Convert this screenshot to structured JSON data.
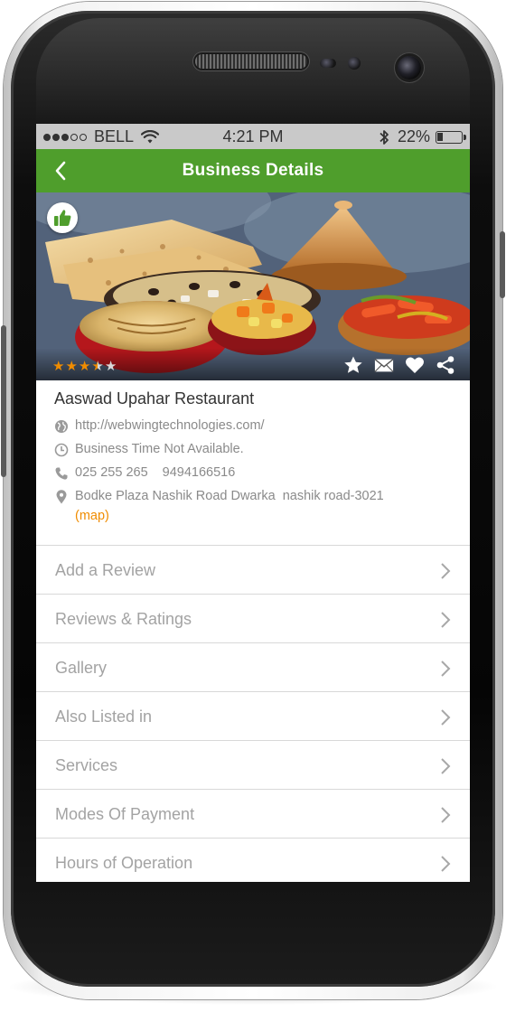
{
  "status_bar": {
    "carrier": "BELL",
    "time": "4:21 PM",
    "battery": "22%",
    "battery_level": 0.22
  },
  "nav": {
    "title": "Business Details",
    "back_icon": "chevron-left-icon"
  },
  "hero": {
    "rating": 3.5,
    "rating_max": 5,
    "badge_icon": "thumbs-up-icon",
    "actions": [
      "star-icon",
      "mail-icon",
      "heart-icon",
      "share-icon"
    ]
  },
  "business": {
    "name": "Aaswad Upahar Restaurant",
    "website": "http://webwingtechnologies.com/",
    "hours": "Business Time Not Available.",
    "phone_1": "025 255 265",
    "phone_2": "9494166516",
    "address": "Bodke Plaza Nashik Road Dwarka  nashik road-3021",
    "map_label": "(map)"
  },
  "menu": {
    "items": [
      {
        "label": "Add a Review"
      },
      {
        "label": "Reviews & Ratings"
      },
      {
        "label": "Gallery"
      },
      {
        "label": "Also Listed in"
      },
      {
        "label": "Services"
      },
      {
        "label": "Modes Of Payment"
      },
      {
        "label": "Hours of Operation"
      }
    ]
  },
  "colors": {
    "nav_green": "#4f9e2c",
    "star_orange": "#f08c00",
    "map_link": "#f08c00",
    "menu_text": "#a3a3a3"
  }
}
